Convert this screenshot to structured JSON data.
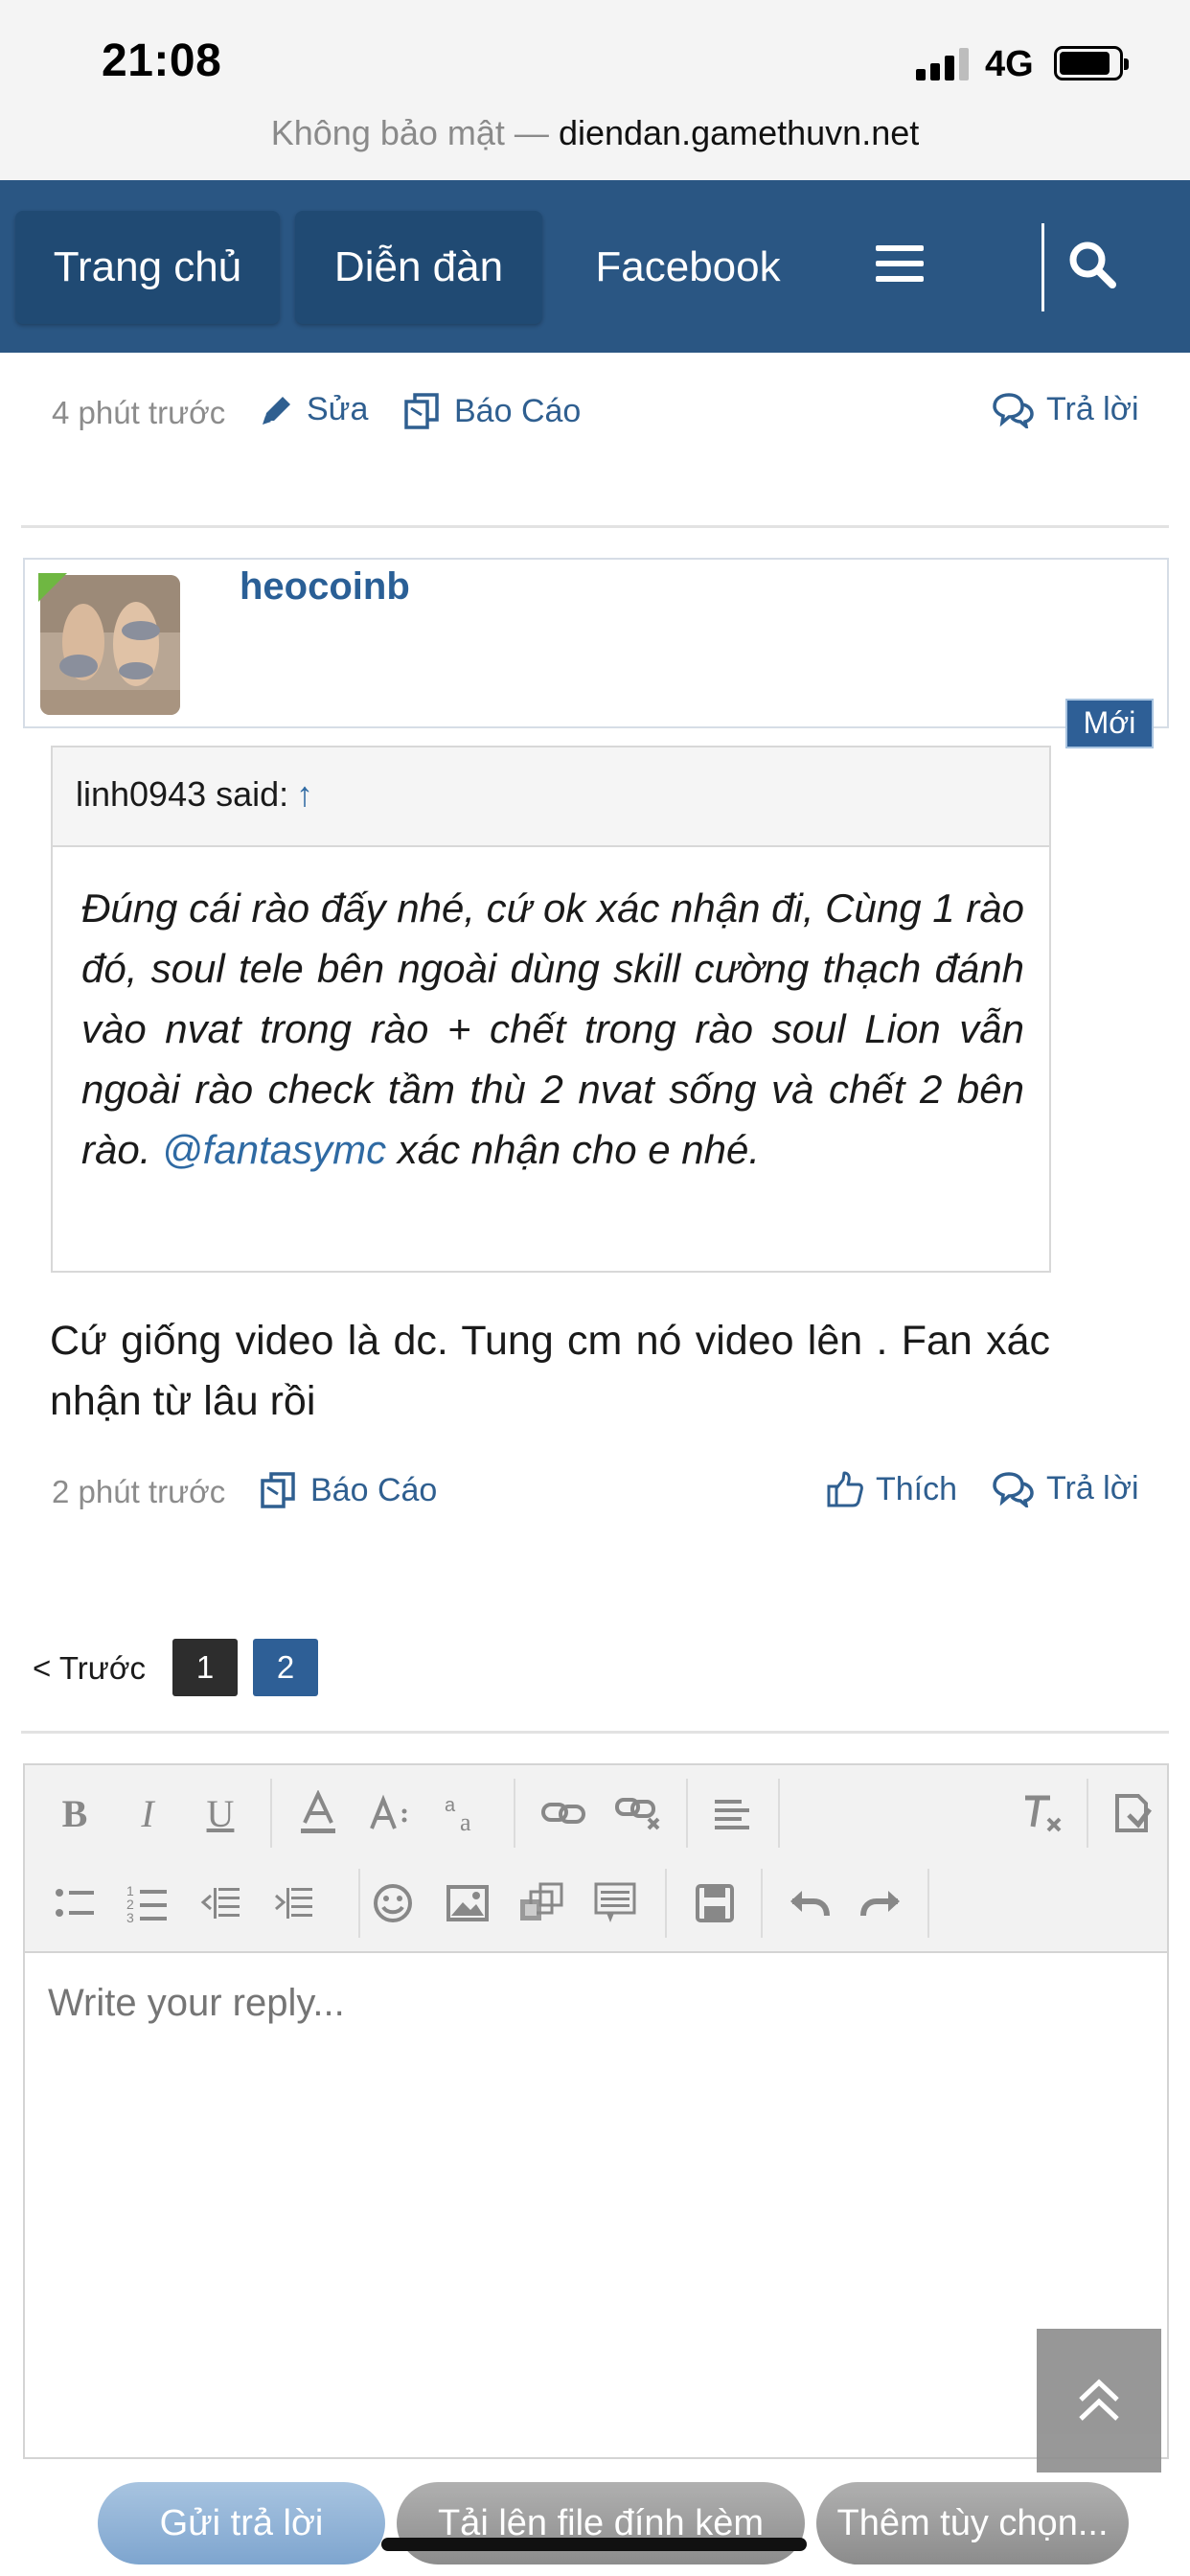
{
  "status_bar": {
    "time": "21:08",
    "network": "4G"
  },
  "url_bar": {
    "prefix": "Không bảo mật —",
    "domain": "diendan.gamethuvn.net"
  },
  "nav": {
    "tabs": [
      "Trang chủ",
      "Diễn đàn",
      "Facebook"
    ],
    "colors": {
      "bar": "#2a5683",
      "active_tab": "#204a73"
    }
  },
  "prev_post": {
    "time": "4 phút trước",
    "edit": "Sửa",
    "report": "Báo Cáo",
    "reply": "Trả lời"
  },
  "post": {
    "username": "heocoinb",
    "badge": "Mới",
    "quote": {
      "author": "linh0943 said:",
      "arrow": "↑",
      "text_before": "Đúng cái rào đấy nhé, cứ ok xác nhận đi, Cùng 1 rào đó, soul tele bên ngoài dùng skill cường thạch đánh vào nvat trong rào + chết trong rào soul Lion vẫn ngoài rào check tầm thù 2 nvat sống và chết 2 bên rào.",
      "mention": "@fantasymc",
      "text_after": "xác nhận cho e nhé."
    },
    "message": "Cứ giống video là dc. Tung cm nó video lên . Fan xác nhận từ lâu rồi",
    "time": "2 phút trước",
    "report": "Báo Cáo",
    "like": "Thích",
    "reply": "Trả lời"
  },
  "pagination": {
    "prev": "< Trước",
    "pages": [
      "1",
      "2"
    ],
    "current": "2"
  },
  "editor": {
    "placeholder": "Write your reply..."
  },
  "buttons": {
    "submit": "Gửi trả lời",
    "upload": "Tải lên file đính kèm",
    "more": "Thêm tùy chọn..."
  }
}
